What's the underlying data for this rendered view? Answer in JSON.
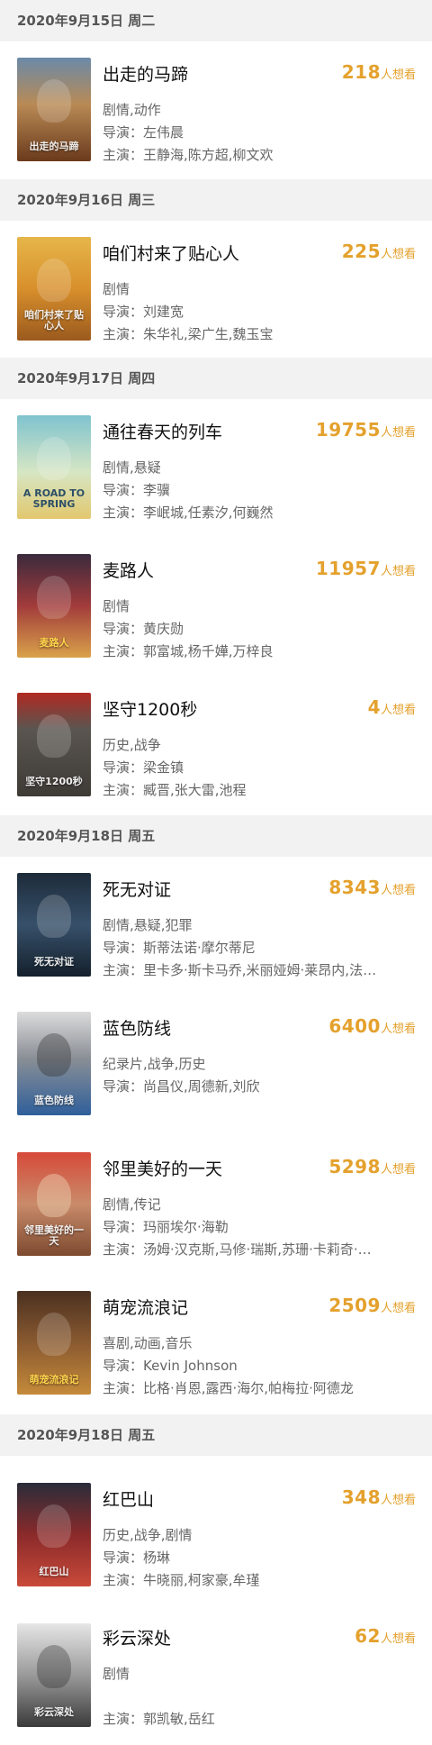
{
  "wish_unit": "人想看",
  "colors": {
    "accent": "#e4a12d",
    "header_bg": "#f2f2f2"
  },
  "sections": [
    {
      "date": "2020年9月15日 周二"
    },
    {
      "date": "2020年9月16日 周三"
    },
    {
      "date": "2020年9月17日 周四"
    },
    {
      "date": "2020年9月18日 周五"
    },
    {
      "date": "2020年9月18日 周五"
    }
  ],
  "movies": [
    {
      "title": "出走的马蹄",
      "wish": "218",
      "genre": "剧情,动作",
      "director": "导演：左伟晨",
      "cast": "主演：王静海,陈方超,柳文欢",
      "poster_text": "出走的马蹄"
    },
    {
      "title": "咱们村来了贴心人",
      "wish": "225",
      "genre": "剧情",
      "director": "导演：刘建宽",
      "cast": "主演：朱华礼,梁广生,魏玉宝",
      "poster_text": "咱们村来了贴心人"
    },
    {
      "title": "通往春天的列车",
      "wish": "19755",
      "genre": "剧情,悬疑",
      "director": "导演：李骥",
      "cast": "主演：李岷城,任素汐,何巍然",
      "poster_text": "A ROAD TO SPRING"
    },
    {
      "title": "麦路人",
      "wish": "11957",
      "genre": "剧情",
      "director": "导演：黄庆勋",
      "cast": "主演：郭富城,杨千嬅,万梓良",
      "poster_text": "麦路人"
    },
    {
      "title": "坚守1200秒",
      "wish": "4",
      "genre": "历史,战争",
      "director": "导演：梁金镇",
      "cast": "主演：臧晋,张大雷,池程",
      "poster_text": "坚守1200秒"
    },
    {
      "title": "死无对证",
      "wish": "8343",
      "genre": "剧情,悬疑,犯罪",
      "director": "导演：斯蒂法诺·摩尔蒂尼",
      "cast": "主演：里卡多·斯卡马乔,米丽娅姆·莱昂内,法…",
      "poster_text": "死无对证"
    },
    {
      "title": "蓝色防线",
      "wish": "6400",
      "genre": "纪录片,战争,历史",
      "director": "导演：尚昌仪,周德新,刘欣",
      "cast": "",
      "poster_text": "蓝色防线"
    },
    {
      "title": "邻里美好的一天",
      "wish": "5298",
      "genre": "剧情,传记",
      "director": "导演：玛丽埃尔·海勒",
      "cast": "主演：汤姆·汉克斯,马修·瑞斯,苏珊·卡莉奇·…",
      "poster_text": "邻里美好的一天"
    },
    {
      "title": "萌宠流浪记",
      "wish": "2509",
      "genre": "喜剧,动画,音乐",
      "director": "导演：Kevin Johnson",
      "cast": "主演：比格·肖恩,露西·海尔,帕梅拉·阿德龙",
      "poster_text": "萌宠流浪记"
    },
    {
      "title": "红巴山",
      "wish": "348",
      "genre": "历史,战争,剧情",
      "director": "导演：杨琳",
      "cast": "主演：牛晓丽,柯家豪,牟瑾",
      "poster_text": "红巴山"
    },
    {
      "title": "彩云深处",
      "wish": "62",
      "genre": "剧情",
      "director": "",
      "cast": "主演：郭凯敏,岳红",
      "poster_text": "彩云深处"
    }
  ]
}
